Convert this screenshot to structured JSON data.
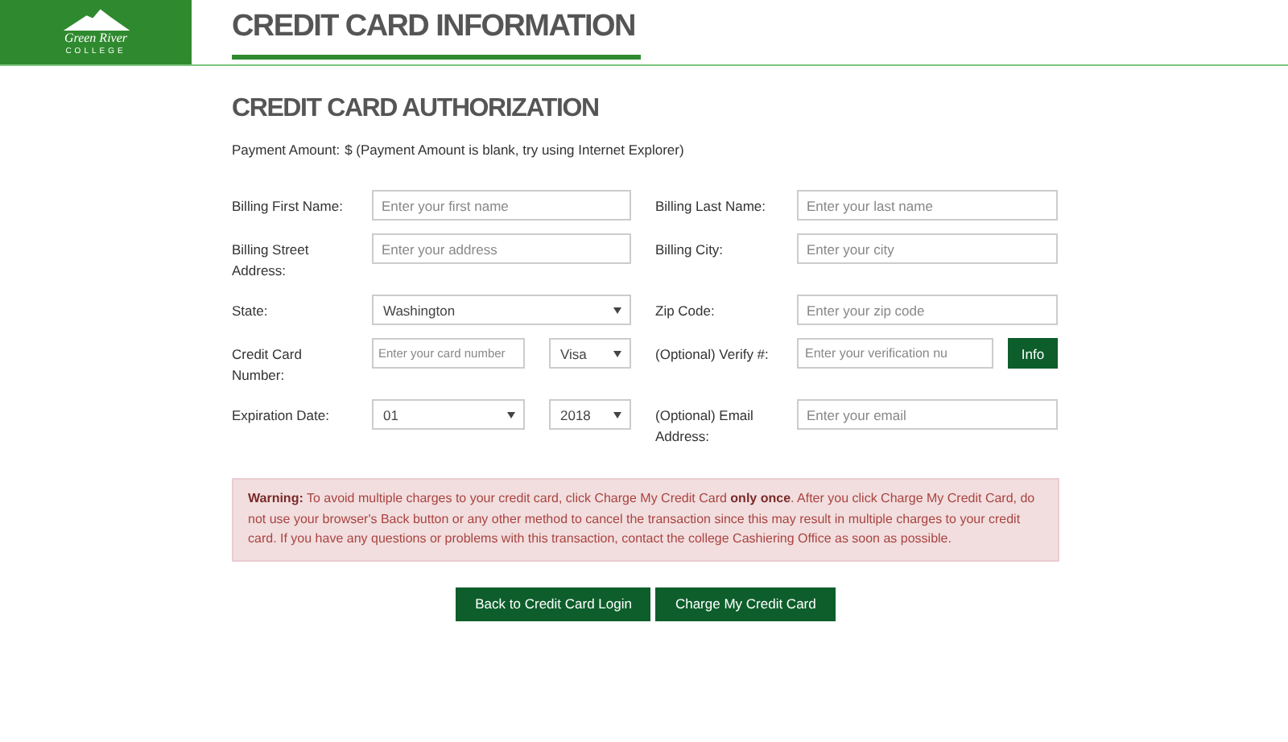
{
  "header": {
    "logo": {
      "name": "Green River",
      "subtitle": "COLLEGE"
    },
    "title": "CREDIT CARD INFORMATION"
  },
  "section": {
    "title": "CREDIT CARD AUTHORIZATION",
    "payment_label": "Payment Amount:",
    "payment_value": "$ (Payment Amount is blank, try using Internet Explorer)"
  },
  "rows": [
    {
      "left": {
        "label": "Billing First Name:",
        "controls": [
          {
            "kind": "text",
            "placeholder": "Enter your first name"
          }
        ]
      },
      "right": {
        "label": "Billing Last Name:",
        "controls": [
          {
            "kind": "text",
            "placeholder": "Enter your last name"
          }
        ]
      }
    },
    {
      "left": {
        "label": "Billing Street Address:",
        "controls": [
          {
            "kind": "text",
            "placeholder": "Enter your address"
          }
        ]
      },
      "right": {
        "label": "Billing City:",
        "controls": [
          {
            "kind": "text",
            "placeholder": "Enter your city"
          }
        ]
      }
    },
    {
      "left": {
        "label": "State:",
        "controls": [
          {
            "kind": "select",
            "value": "Washington"
          }
        ]
      },
      "right": {
        "label": "Zip Code:",
        "controls": [
          {
            "kind": "text",
            "placeholder": "Enter your zip code"
          }
        ]
      }
    },
    {
      "left": {
        "label": "Credit Card Number:",
        "controls": [
          {
            "kind": "text",
            "placeholder": "Enter your card number"
          },
          {
            "kind": "select",
            "value": "Visa"
          }
        ]
      },
      "right": {
        "label": "(Optional) Verify #:",
        "controls": [
          {
            "kind": "text",
            "placeholder": "Enter your verification nu"
          },
          {
            "kind": "button",
            "label": "Info"
          }
        ]
      }
    },
    {
      "left": {
        "label": "Expiration Date:",
        "controls": [
          {
            "kind": "select",
            "value": "01"
          },
          {
            "kind": "select",
            "value": "2018"
          }
        ]
      },
      "right": {
        "label": "(Optional) Email Address:",
        "controls": [
          {
            "kind": "text",
            "placeholder": "Enter your email"
          }
        ]
      }
    }
  ],
  "warning": "**Warning:** To avoid multiple charges to your credit card, click Charge My Credit Card **only once**. After you click Charge My Credit Card, do not use your browser's Back button or any other method to cancel the transaction since this may result in multiple charges to your credit card. If you have any questions or problems with this transaction, contact the college Cashiering Office as soon as possible.",
  "buttons": [
    "Back to Credit Card Login",
    "Charge My Credit Card"
  ]
}
